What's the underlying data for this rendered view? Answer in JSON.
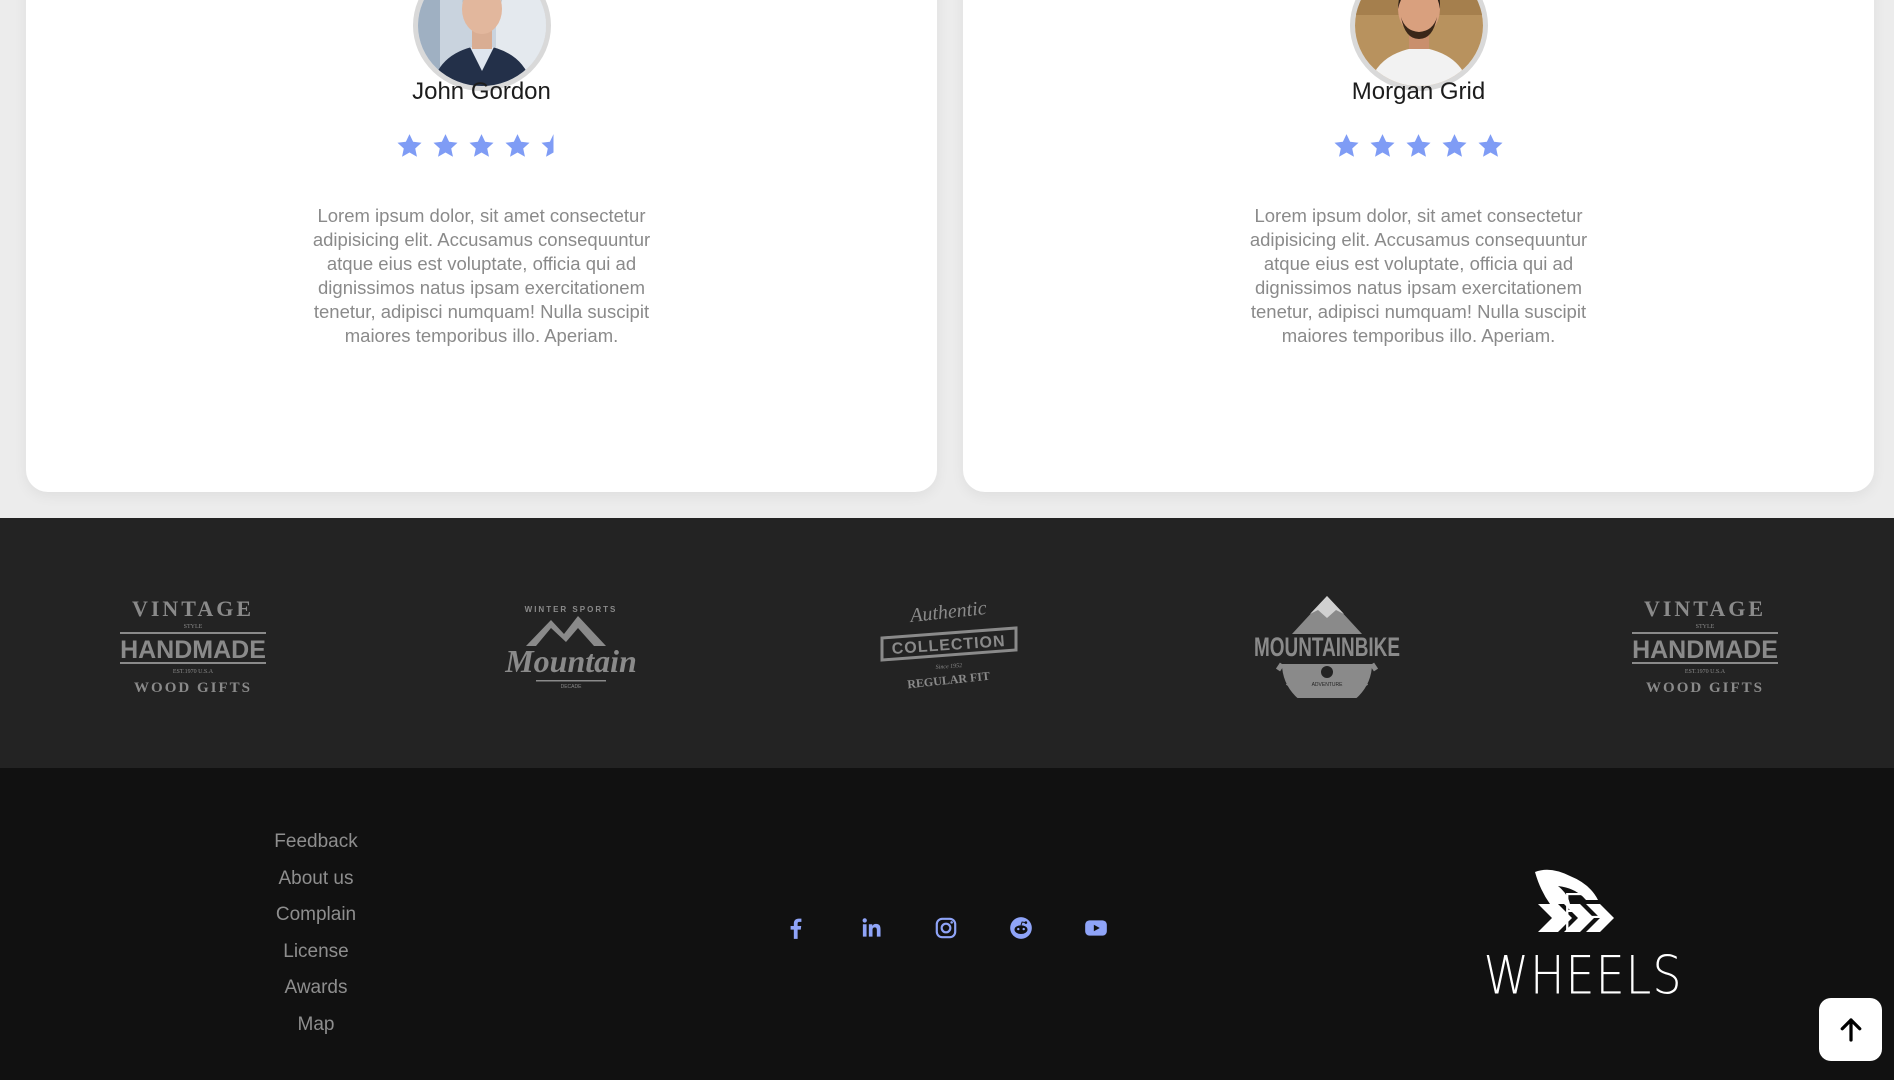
{
  "testimonials": [
    {
      "name": "John Gordon",
      "rating": 4.5,
      "text": "Lorem ipsum dolor, sit amet consectetur adipisicing elit. Accusamus consequuntur atque eius est voluptate, officia qui ad dignissimos natus ipsam exercitationem tenetur, adipisci numquam! Nulla suscipit maiores temporibus illo. Aperiam."
    },
    {
      "name": "Morgan Grid",
      "rating": 5,
      "text": "Lorem ipsum dolor, sit amet consectetur adipisicing elit. Accusamus consequuntur atque eius est voluptate, officia qui ad dignissimos natus ipsam exercitationem tenetur, adipisci numquam! Nulla suscipit maiores temporibus illo. Aperiam."
    }
  ],
  "partner_logos": [
    {
      "top": "VINTAGE",
      "small": "STYLE",
      "main": "HANDMADE",
      "sub": "EST.1970 U.S.A",
      "bottom": "WOOD GIFTS"
    },
    {
      "top": "WINTER SPORTS",
      "main": "Mountain",
      "sub": "DECADE"
    },
    {
      "top": "Authentic",
      "main": "COLLECTION",
      "small": "Since 1952",
      "bottom": "REGULAR FIT"
    },
    {
      "main": "MOUNTAINBIKE",
      "sub": "ADVENTURE"
    },
    {
      "top": "VINTAGE",
      "small": "STYLE",
      "main": "HANDMADE",
      "sub": "EST.1970 U.S.A",
      "bottom": "WOOD GIFTS"
    }
  ],
  "footer": {
    "links": [
      "Feedback",
      "About us",
      "Complain",
      "License",
      "Awards",
      "Map"
    ],
    "socials": [
      "facebook-icon",
      "linkedin-icon",
      "instagram-icon",
      "reddit-icon",
      "youtube-icon"
    ],
    "brand_name": "F-WHEELS"
  },
  "colors": {
    "star": "#7f9cf5",
    "social": "#8fa4f8",
    "logos_bg": "#232323",
    "footer_bg": "#111111"
  }
}
